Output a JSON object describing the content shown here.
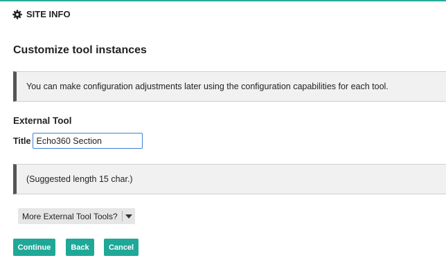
{
  "header": {
    "site_info_label": "SITE INFO",
    "icon": "gear-icon",
    "accent_color": "#27a99a"
  },
  "page": {
    "title": "Customize tool instances"
  },
  "notice": {
    "text": "You can make configuration adjustments later using the configuration capabilities for each tool."
  },
  "external_tool": {
    "heading": "External Tool",
    "title_label": "Title",
    "title_value": "Echo360 Section",
    "hint": "(Suggested length 15 char.)"
  },
  "more_tools": {
    "label": "More External Tool Tools?",
    "icon": "chevron-down-icon"
  },
  "actions": {
    "continue_label": "Continue",
    "back_label": "Back",
    "cancel_label": "Cancel",
    "button_color": "#1fa898"
  }
}
